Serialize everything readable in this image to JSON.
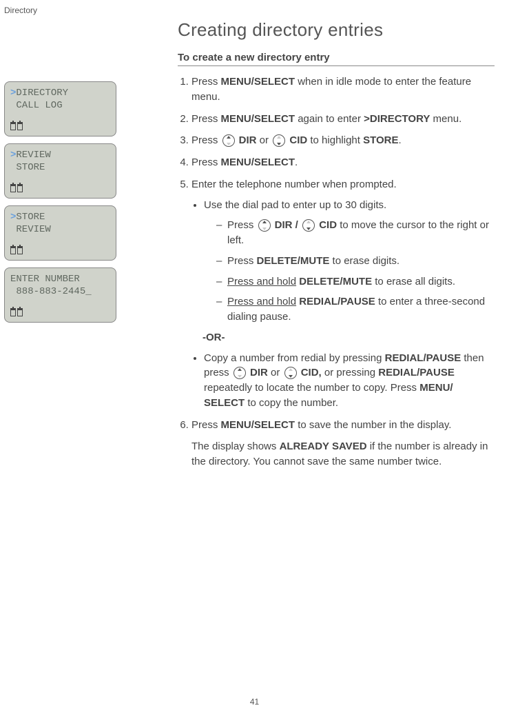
{
  "header": {
    "section": "Directory"
  },
  "screens": [
    {
      "line1_caret": ">",
      "line1": "DIRECTORY",
      "line2": " CALL LOG"
    },
    {
      "line1_caret": ">",
      "line1": "REVIEW",
      "line2": " STORE"
    },
    {
      "line1_caret": ">",
      "line1": "STORE",
      "line2": " REVIEW"
    },
    {
      "line1_caret": "",
      "line1": "ENTER NUMBER",
      "line2": " 888-883-2445_"
    }
  ],
  "title": "Creating directory entries",
  "subtitle": "To create a new directory entry",
  "steps": {
    "s1_a": "Press ",
    "s1_b": "MENU/",
    "s1_c": "SELECT",
    "s1_d": " when in idle mode to enter the feature menu.",
    "s2_a": "Press ",
    "s2_b": "MENU",
    "s2_c": "/SELECT",
    "s2_d": " again to enter ",
    "s2_e": ">DIRECTORY",
    "s2_f": " menu.",
    "s3_a": "Press ",
    "s3_dir": " DIR",
    "s3_or": " or ",
    "s3_cid": " CID",
    "s3_b": " to highlight ",
    "s3_c": "STORE",
    "s3_d": ".",
    "s4_a": "Press ",
    "s4_b": "MENU",
    "s4_c": "/SELECT",
    "s4_d": ".",
    "s5": "Enter the telephone number when prompted.",
    "s5_b1": "Use the dial pad to enter up to 30 digits.",
    "s5_d1_a": "Press ",
    "s5_d1_dir": " DIR / ",
    "s5_d1_cid": " CID",
    "s5_d1_b": " to move the cursor to the right or left.",
    "s5_d2_a": "Press ",
    "s5_d2_b": "DELETE",
    "s5_d2_c": "/MUTE",
    "s5_d2_d": " to erase digits.",
    "s5_d3_a": "Press and hold",
    "s5_d3_b": " DELETE",
    "s5_d3_c": "/MUTE",
    "s5_d3_d": " to erase all digits.",
    "s5_d4_a": "Press and hold",
    "s5_d4_b": " REDIAL/",
    "s5_d4_c": "PAUSE",
    "s5_d4_d": " to enter a three-second dialing pause.",
    "or": "-OR-",
    "s5_b2_a": "Copy a number from redial by pressing ",
    "s5_b2_b": "REDIAL",
    "s5_b2_c": "/PAUSE",
    "s5_b2_d": " then press ",
    "s5_b2_dir": " DIR",
    "s5_b2_or": " or ",
    "s5_b2_cid": " CID,",
    "s5_b2_e": " or pressing ",
    "s5_b2_f": "REDIAL",
    "s5_b2_g": "/PAUSE",
    "s5_b2_h": " repeatedly to locate the number to copy. Press ",
    "s5_b2_i": "MENU/",
    "s5_b2_j": " SELECT",
    "s5_b2_k": " to copy the number.",
    "s6_a": "Press ",
    "s6_b": "MENU",
    "s6_c": "/SELECT",
    "s6_d": " to save the number in the display.",
    "s6_note_a": "The display shows ",
    "s6_note_b": "ALREADY SAVED",
    "s6_note_c": " if the number is already in the directory. You cannot save the same number twice."
  },
  "page": "41"
}
